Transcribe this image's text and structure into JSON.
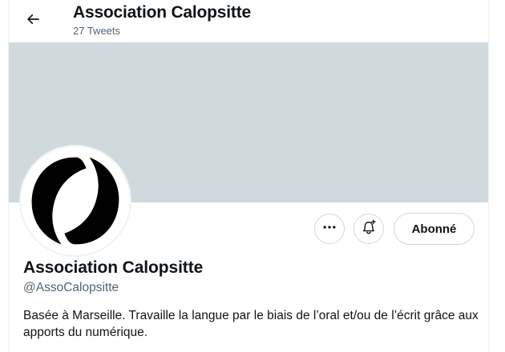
{
  "header": {
    "title": "Association Calopsitte",
    "subtitle": "27 Tweets",
    "back_icon": "arrow-left-icon"
  },
  "colors": {
    "banner": "#cfd9de",
    "text_primary": "#0f1419",
    "text_secondary": "#536471",
    "border": "#cfd9de"
  },
  "profile": {
    "avatar_icon": "calopsitte-logo",
    "display_name": "Association Calopsitte",
    "handle": "@AssoCalopsitte",
    "bio": "Basée à Marseille. Travaille la langue par le biais de l’oral et/ou de l’écrit grâce aux apports du numérique."
  },
  "actions": {
    "more_icon": "more-horizontal-icon",
    "notifications_icon": "bell-plus-icon",
    "follow_label": "Abonné"
  }
}
